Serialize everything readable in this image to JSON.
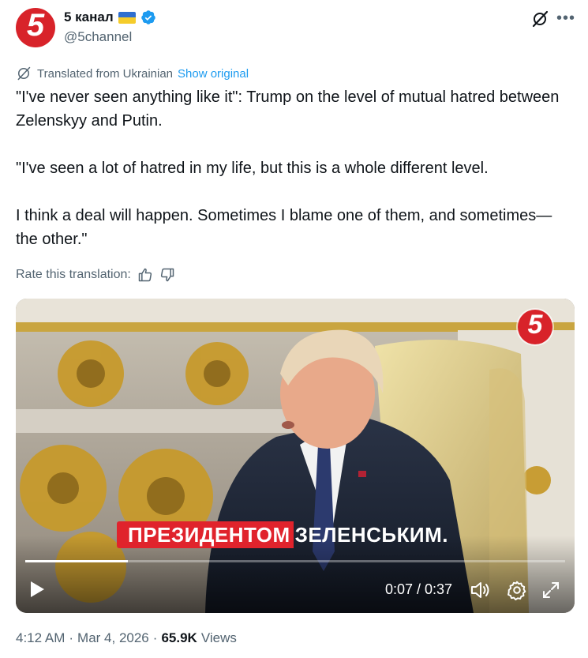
{
  "author": {
    "display_name": "5 канал",
    "handle": "@5channel",
    "avatar_text": "5",
    "flag": "ukraine-flag",
    "verified": true
  },
  "translation": {
    "notice": "Translated from Ukrainian",
    "show_original": "Show original",
    "rate_label": "Rate this translation:"
  },
  "tweet": {
    "paragraphs": [
      "\"I've never seen anything like it\": Trump on the level of mutual hatred between Zelenskyy and Putin.",
      "\"I've seen a lot of hatred in my life, but this is a whole different level.",
      "I think a deal will happen. Sometimes I blame one of them, and sometimes—the other.\""
    ]
  },
  "video": {
    "caption_highlight": "ПРЕЗИДЕНТОМ",
    "caption_rest": "ЗЕЛЕНСЬКИМ.",
    "channel_logo": "5",
    "time": "0:07 / 0:37",
    "progress": 0.19
  },
  "meta": {
    "time": "4:12 AM",
    "date": "Mar 4, 2026",
    "views_count": "65.9K",
    "views_label": "Views",
    "separator": "·"
  },
  "colors": {
    "accent": "#1d9bf0",
    "brand_red": "#d8232a",
    "text_secondary": "#536471"
  }
}
